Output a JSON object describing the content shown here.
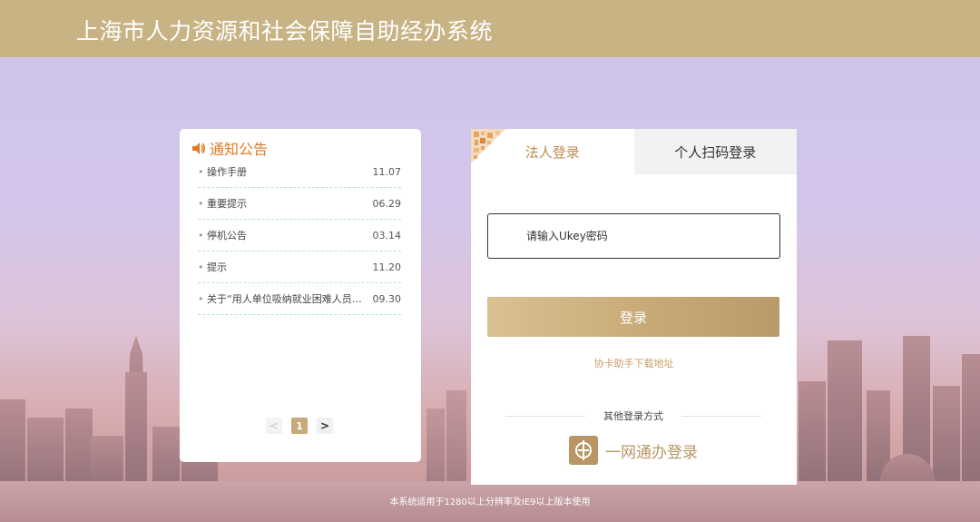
{
  "header": {
    "title": "上海市人力资源和社会保障自助经办系统"
  },
  "colors": {
    "header_bg": "#c8b384",
    "accent": "#c8aa77",
    "notice_title": "#e07a26"
  },
  "notice": {
    "icon": "speaker-icon",
    "title": "通知公告",
    "items": [
      {
        "text": "操作手册",
        "date": "11.07"
      },
      {
        "text": "重要提示",
        "date": "06.29"
      },
      {
        "text": "停机公告",
        "date": "03.14"
      },
      {
        "text": "提示",
        "date": "11.20"
      },
      {
        "text": "关于“用人单位吸纳就业困难人员岗位...",
        "date": "09.30"
      }
    ],
    "pager": {
      "prev": "<",
      "current": "1",
      "next": ">"
    }
  },
  "login": {
    "tabs": [
      {
        "label": "法人登录"
      },
      {
        "label": "个人扫码登录"
      }
    ],
    "ukey_placeholder": "请输入Ukey密码",
    "login_label": "登录",
    "download_link": "协卡助手下载地址",
    "other_methods": "其他登录方式",
    "ywtb_label": "一网通办登录"
  },
  "footer": {
    "note": "本系统适用于1280以上分辨率及IE9以上版本使用"
  }
}
